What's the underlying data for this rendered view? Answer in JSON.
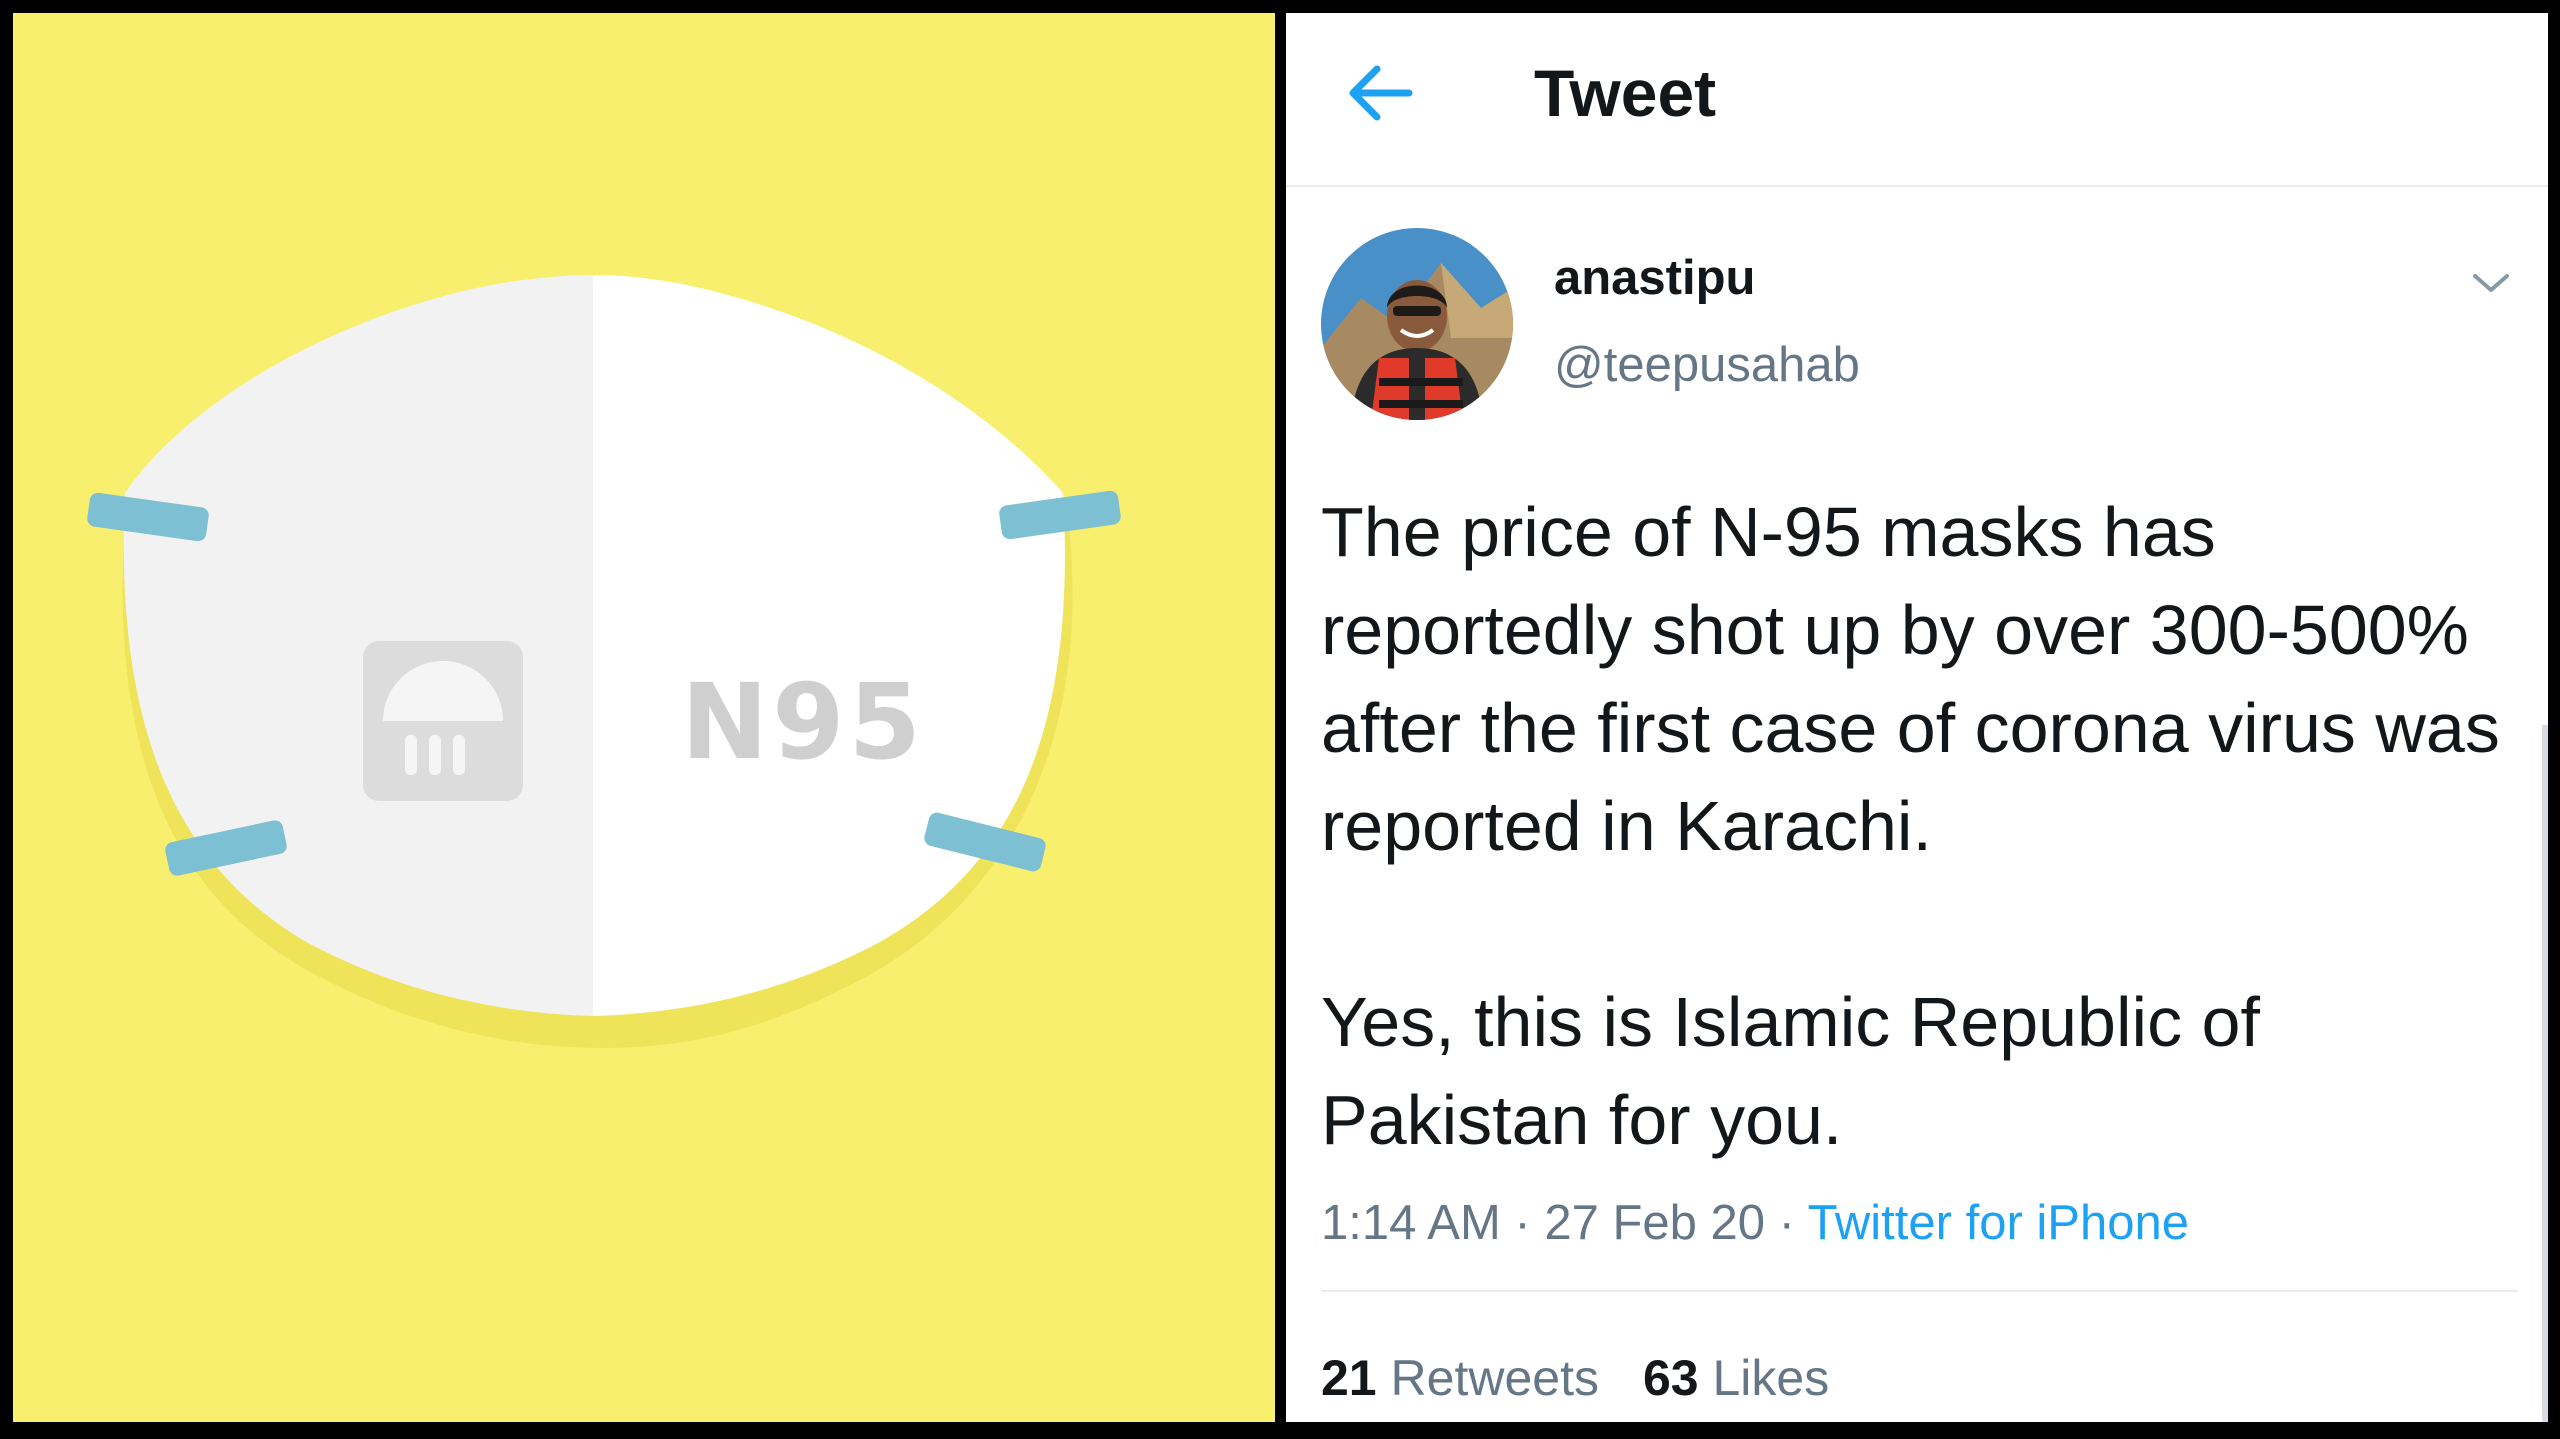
{
  "illustration": {
    "mask_label": "N95",
    "colors": {
      "background": "#f8ef6f",
      "mask_left": "#f2f2f2",
      "mask_right": "#ffffff",
      "strap": "#7dbfd3",
      "valve": "#dcdcdc"
    }
  },
  "header": {
    "back_icon": "arrow-left-icon",
    "title": "Tweet"
  },
  "tweet": {
    "display_name": "anastipu",
    "handle": "@teepusahab",
    "menu_icon": "chevron-down-icon",
    "text_paragraph_1": "The price of N-95 masks has reportedly shot up by over 300-500% after the first case of corona virus was reported in Karachi.",
    "text_paragraph_2": "Yes, this is Islamic Republic of Pakistan for you.",
    "time": "1:14 AM",
    "date": "27 Feb 20",
    "source": "Twitter for iPhone",
    "separator": " · ",
    "retweets_count": "21",
    "retweets_label": "Retweets",
    "likes_count": "63",
    "likes_label": "Likes"
  },
  "colors": {
    "accent": "#1da1f2",
    "secondary_text": "#657786",
    "primary_text": "#14171a"
  }
}
